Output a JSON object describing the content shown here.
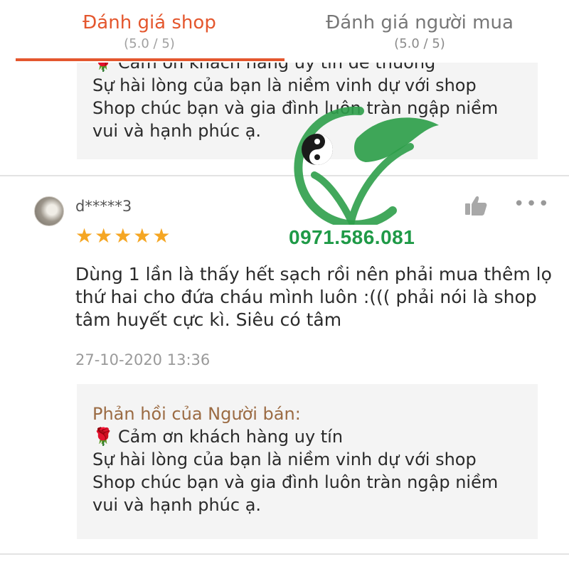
{
  "tabs": {
    "shop": {
      "title": "Đánh giá shop",
      "score": "(5.0 / 5)"
    },
    "buyer": {
      "title": "Đánh giá người mua",
      "score": "(5.0 / 5)"
    }
  },
  "top_reply": {
    "lines": [
      "Cảm ơn khách hàng uy tín dễ thương",
      "Sự hài lòng của bạn là niềm vinh dự với shop",
      "Shop chúc bạn và gia đình luôn tràn ngập niềm",
      "vui và hạnh phúc ạ."
    ]
  },
  "review": {
    "username": "d*****3",
    "stars": "★★★★★",
    "rating": 5,
    "text_lines": [
      "Dùng 1 lần là thấy hết sạch rồi nên phải mua thêm lọ",
      "thứ hai cho đứa cháu mình luôn :((( phải nói là shop",
      "tâm huyết cực kì. Siêu có tâm"
    ],
    "timestamp": "27-10-2020 13:36",
    "more": "•••"
  },
  "seller_reply": {
    "title": "Phản hồi của Người bán:",
    "lines": [
      "Cảm ơn khách hàng uy tín",
      "Sự hài lòng của bạn là niềm vinh dự với shop",
      "Shop chúc bạn và gia đình luôn tràn ngập niềm",
      "vui và hạnh phúc ạ."
    ],
    "rose_icon": "🌹"
  },
  "watermark": {
    "phone": "0971.586.081"
  },
  "colors": {
    "accent": "#e4572e",
    "star": "#f5a623",
    "reply_title": "#9b6b43",
    "brand_green": "#1f9a47"
  }
}
